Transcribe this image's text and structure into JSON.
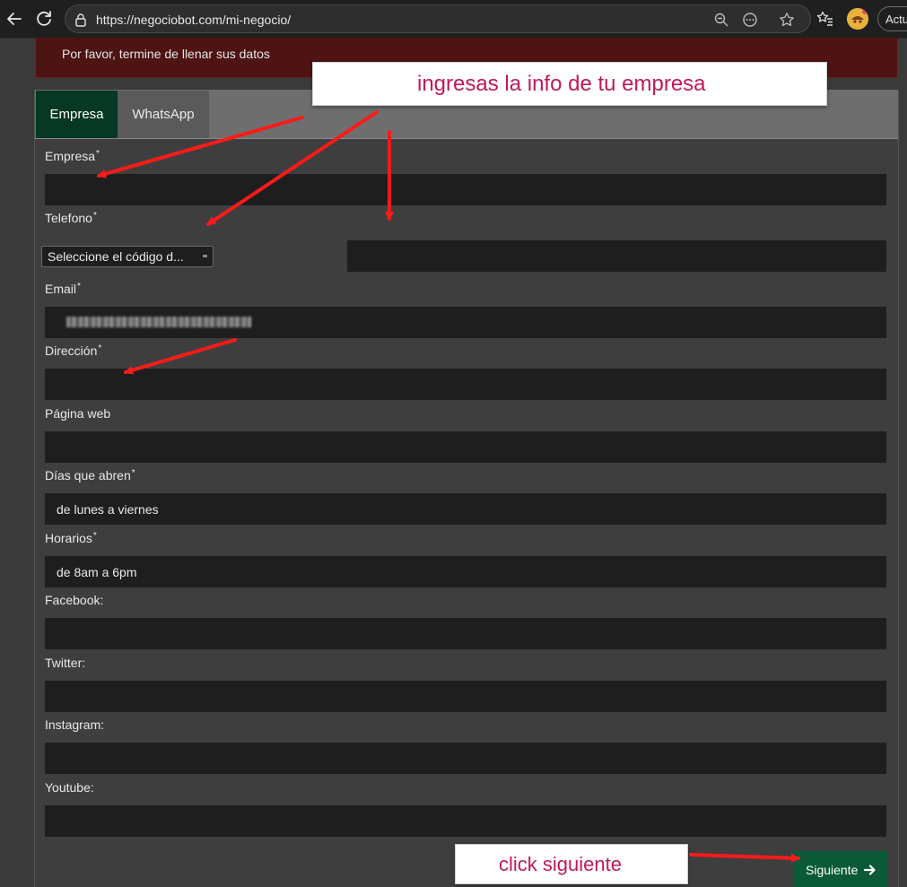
{
  "browser": {
    "url": "https://negociobot.com/mi-negocio/",
    "update_label": "Actu"
  },
  "alert": {
    "text": "Por favor, termine de llenar sus datos"
  },
  "tabs": [
    {
      "label": "Empresa",
      "active": true
    },
    {
      "label": "WhatsApp",
      "active": false
    }
  ],
  "form": {
    "empresa": {
      "label": "Empresa",
      "required": "*",
      "value": ""
    },
    "telefono": {
      "label": "Telefono",
      "required": "*",
      "country_select": "Seleccione el código d...",
      "value": ""
    },
    "email": {
      "label": "Email",
      "required": "*"
    },
    "direccion": {
      "label": "Dirección",
      "required": "*",
      "value": ""
    },
    "pagina_web": {
      "label": "Página web",
      "value": ""
    },
    "dias": {
      "label": "Días que abren",
      "required": "*",
      "value": "de lunes a viernes"
    },
    "horarios": {
      "label": "Horarios",
      "required": "*",
      "value": "de 8am a 6pm"
    },
    "facebook": {
      "label": "Facebook:",
      "value": ""
    },
    "twitter": {
      "label": "Twitter:",
      "value": ""
    },
    "instagram": {
      "label": "Instagram:",
      "value": ""
    },
    "youtube": {
      "label": "Youtube:",
      "value": ""
    },
    "next_label": "Siguiente"
  },
  "annotations": {
    "top_note": "ingresas la info de tu empresa",
    "bottom_note": "click siguiente",
    "color": "#c0185a",
    "arrow_color": "#ff1a1a"
  },
  "colors": {
    "active_tab": "#063823",
    "button": "#0b5a37",
    "alert": "#4e1313"
  }
}
